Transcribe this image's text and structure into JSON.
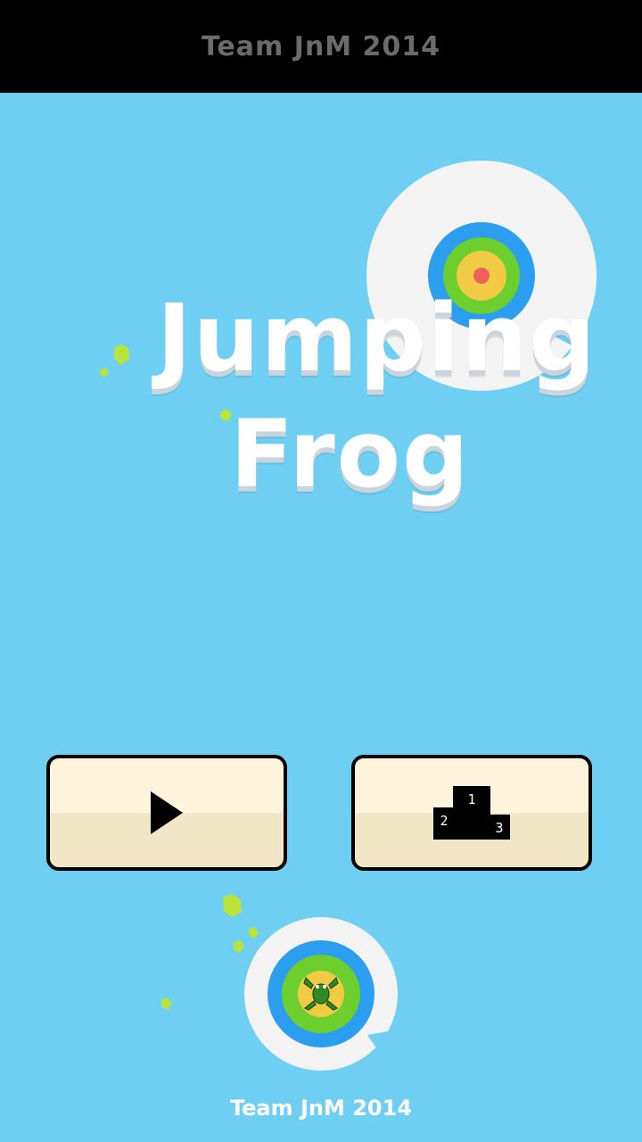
{
  "header": {
    "credit": "Team JnM 2014"
  },
  "title": {
    "line1": "Jumping",
    "line2": "Frog"
  },
  "buttons": {
    "play": {
      "icon": "play-icon"
    },
    "leaderboard": {
      "icon": "podium-icon",
      "place1": "1",
      "place2": "2",
      "place3": "3"
    }
  },
  "footer": {
    "credit": "Team JnM 2014"
  },
  "colors": {
    "background": "#6fcff2",
    "topbar": "#000000",
    "button_top": "#fef4dc",
    "button_bottom": "#f1e6c5",
    "target_blue": "#2b9ef0",
    "target_green": "#6ccf2e",
    "target_yellow": "#f2cb45",
    "target_red": "#f0605a",
    "lilypad": "#b9e23a"
  }
}
